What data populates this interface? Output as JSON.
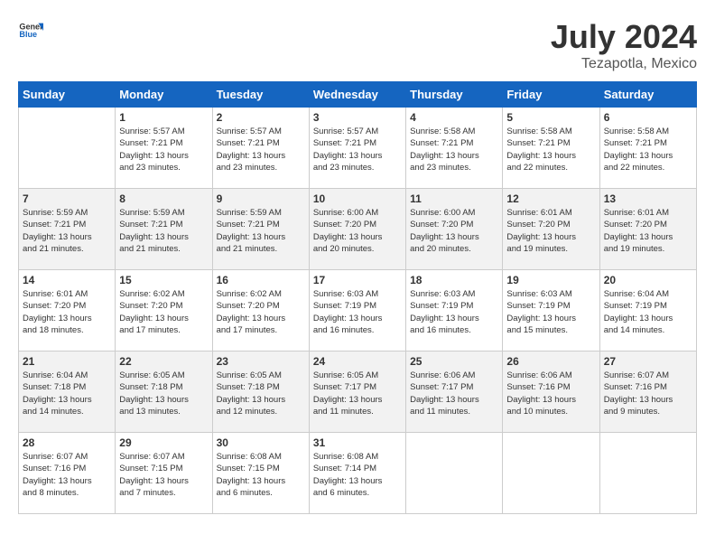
{
  "header": {
    "logo_general": "General",
    "logo_blue": "Blue",
    "month": "July 2024",
    "location": "Tezapotla, Mexico"
  },
  "weekdays": [
    "Sunday",
    "Monday",
    "Tuesday",
    "Wednesday",
    "Thursday",
    "Friday",
    "Saturday"
  ],
  "weeks": [
    [
      {
        "day": "",
        "info": ""
      },
      {
        "day": "1",
        "info": "Sunrise: 5:57 AM\nSunset: 7:21 PM\nDaylight: 13 hours\nand 23 minutes."
      },
      {
        "day": "2",
        "info": "Sunrise: 5:57 AM\nSunset: 7:21 PM\nDaylight: 13 hours\nand 23 minutes."
      },
      {
        "day": "3",
        "info": "Sunrise: 5:57 AM\nSunset: 7:21 PM\nDaylight: 13 hours\nand 23 minutes."
      },
      {
        "day": "4",
        "info": "Sunrise: 5:58 AM\nSunset: 7:21 PM\nDaylight: 13 hours\nand 23 minutes."
      },
      {
        "day": "5",
        "info": "Sunrise: 5:58 AM\nSunset: 7:21 PM\nDaylight: 13 hours\nand 22 minutes."
      },
      {
        "day": "6",
        "info": "Sunrise: 5:58 AM\nSunset: 7:21 PM\nDaylight: 13 hours\nand 22 minutes."
      }
    ],
    [
      {
        "day": "7",
        "info": "Sunrise: 5:59 AM\nSunset: 7:21 PM\nDaylight: 13 hours\nand 21 minutes."
      },
      {
        "day": "8",
        "info": "Sunrise: 5:59 AM\nSunset: 7:21 PM\nDaylight: 13 hours\nand 21 minutes."
      },
      {
        "day": "9",
        "info": "Sunrise: 5:59 AM\nSunset: 7:21 PM\nDaylight: 13 hours\nand 21 minutes."
      },
      {
        "day": "10",
        "info": "Sunrise: 6:00 AM\nSunset: 7:20 PM\nDaylight: 13 hours\nand 20 minutes."
      },
      {
        "day": "11",
        "info": "Sunrise: 6:00 AM\nSunset: 7:20 PM\nDaylight: 13 hours\nand 20 minutes."
      },
      {
        "day": "12",
        "info": "Sunrise: 6:01 AM\nSunset: 7:20 PM\nDaylight: 13 hours\nand 19 minutes."
      },
      {
        "day": "13",
        "info": "Sunrise: 6:01 AM\nSunset: 7:20 PM\nDaylight: 13 hours\nand 19 minutes."
      }
    ],
    [
      {
        "day": "14",
        "info": "Sunrise: 6:01 AM\nSunset: 7:20 PM\nDaylight: 13 hours\nand 18 minutes."
      },
      {
        "day": "15",
        "info": "Sunrise: 6:02 AM\nSunset: 7:20 PM\nDaylight: 13 hours\nand 17 minutes."
      },
      {
        "day": "16",
        "info": "Sunrise: 6:02 AM\nSunset: 7:20 PM\nDaylight: 13 hours\nand 17 minutes."
      },
      {
        "day": "17",
        "info": "Sunrise: 6:03 AM\nSunset: 7:19 PM\nDaylight: 13 hours\nand 16 minutes."
      },
      {
        "day": "18",
        "info": "Sunrise: 6:03 AM\nSunset: 7:19 PM\nDaylight: 13 hours\nand 16 minutes."
      },
      {
        "day": "19",
        "info": "Sunrise: 6:03 AM\nSunset: 7:19 PM\nDaylight: 13 hours\nand 15 minutes."
      },
      {
        "day": "20",
        "info": "Sunrise: 6:04 AM\nSunset: 7:19 PM\nDaylight: 13 hours\nand 14 minutes."
      }
    ],
    [
      {
        "day": "21",
        "info": "Sunrise: 6:04 AM\nSunset: 7:18 PM\nDaylight: 13 hours\nand 14 minutes."
      },
      {
        "day": "22",
        "info": "Sunrise: 6:05 AM\nSunset: 7:18 PM\nDaylight: 13 hours\nand 13 minutes."
      },
      {
        "day": "23",
        "info": "Sunrise: 6:05 AM\nSunset: 7:18 PM\nDaylight: 13 hours\nand 12 minutes."
      },
      {
        "day": "24",
        "info": "Sunrise: 6:05 AM\nSunset: 7:17 PM\nDaylight: 13 hours\nand 11 minutes."
      },
      {
        "day": "25",
        "info": "Sunrise: 6:06 AM\nSunset: 7:17 PM\nDaylight: 13 hours\nand 11 minutes."
      },
      {
        "day": "26",
        "info": "Sunrise: 6:06 AM\nSunset: 7:16 PM\nDaylight: 13 hours\nand 10 minutes."
      },
      {
        "day": "27",
        "info": "Sunrise: 6:07 AM\nSunset: 7:16 PM\nDaylight: 13 hours\nand 9 minutes."
      }
    ],
    [
      {
        "day": "28",
        "info": "Sunrise: 6:07 AM\nSunset: 7:16 PM\nDaylight: 13 hours\nand 8 minutes."
      },
      {
        "day": "29",
        "info": "Sunrise: 6:07 AM\nSunset: 7:15 PM\nDaylight: 13 hours\nand 7 minutes."
      },
      {
        "day": "30",
        "info": "Sunrise: 6:08 AM\nSunset: 7:15 PM\nDaylight: 13 hours\nand 6 minutes."
      },
      {
        "day": "31",
        "info": "Sunrise: 6:08 AM\nSunset: 7:14 PM\nDaylight: 13 hours\nand 6 minutes."
      },
      {
        "day": "",
        "info": ""
      },
      {
        "day": "",
        "info": ""
      },
      {
        "day": "",
        "info": ""
      }
    ]
  ]
}
